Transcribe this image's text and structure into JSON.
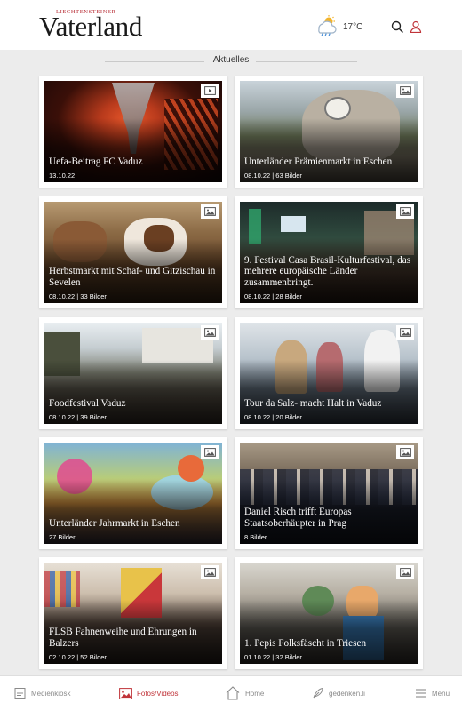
{
  "header": {
    "logo_kicker": "LIECHTENSTEINER",
    "logo_main": "Vaterland",
    "temperature": "17°C",
    "weather_icon": "cloud-sun-rain-icon",
    "accent": "#b5252e"
  },
  "section": {
    "title": "Aktuelles"
  },
  "cards": [
    {
      "title": "Uefa-Beitrag FC Vaduz",
      "meta": "13.10.22",
      "media": "video"
    },
    {
      "title": "Unterländer Prämienmarkt in Eschen",
      "meta": "08.10.22 | 63 Bilder",
      "media": "gallery"
    },
    {
      "title": "Herbstmarkt mit Schaf- und Gitzischau in Sevelen",
      "meta": "08.10.22 | 33 Bilder",
      "media": "gallery"
    },
    {
      "title": "9. Festival Casa Brasil-Kulturfestival, das mehrere europäische Länder zusammenbringt.",
      "meta": "08.10.22 | 28 Bilder",
      "media": "gallery"
    },
    {
      "title": "Foodfestival Vaduz",
      "meta": "08.10.22 | 39 Bilder",
      "media": "gallery"
    },
    {
      "title": "Tour da Salz- macht Halt in Vaduz",
      "meta": "08.10.22 | 20 Bilder",
      "media": "gallery"
    },
    {
      "title": "Unterländer Jahrmarkt in Eschen",
      "meta": "27 Bilder",
      "media": "gallery"
    },
    {
      "title": "Daniel Risch trifft Europas Staatsoberhäupter in Prag",
      "meta": "8 Bilder",
      "media": "gallery"
    },
    {
      "title": "FLSB Fahnenweihe und Ehrungen in Balzers",
      "meta": "02.10.22 | 52 Bilder",
      "media": "gallery"
    },
    {
      "title": "1. Pepis Folksfäscht in Triesen",
      "meta": "01.10.22 | 32 Bilder",
      "media": "gallery"
    }
  ],
  "nav": {
    "items": [
      {
        "label": "Medienkiosk",
        "icon": "newspaper-icon"
      },
      {
        "label": "Fotos/Videos",
        "icon": "photo-icon",
        "active": true
      },
      {
        "label": "Home",
        "icon": "home-icon"
      },
      {
        "label": "gedenken.li",
        "icon": "feather-icon"
      },
      {
        "label": "Menü",
        "icon": "hamburger-icon"
      }
    ],
    "active_color": "#c0343a"
  }
}
